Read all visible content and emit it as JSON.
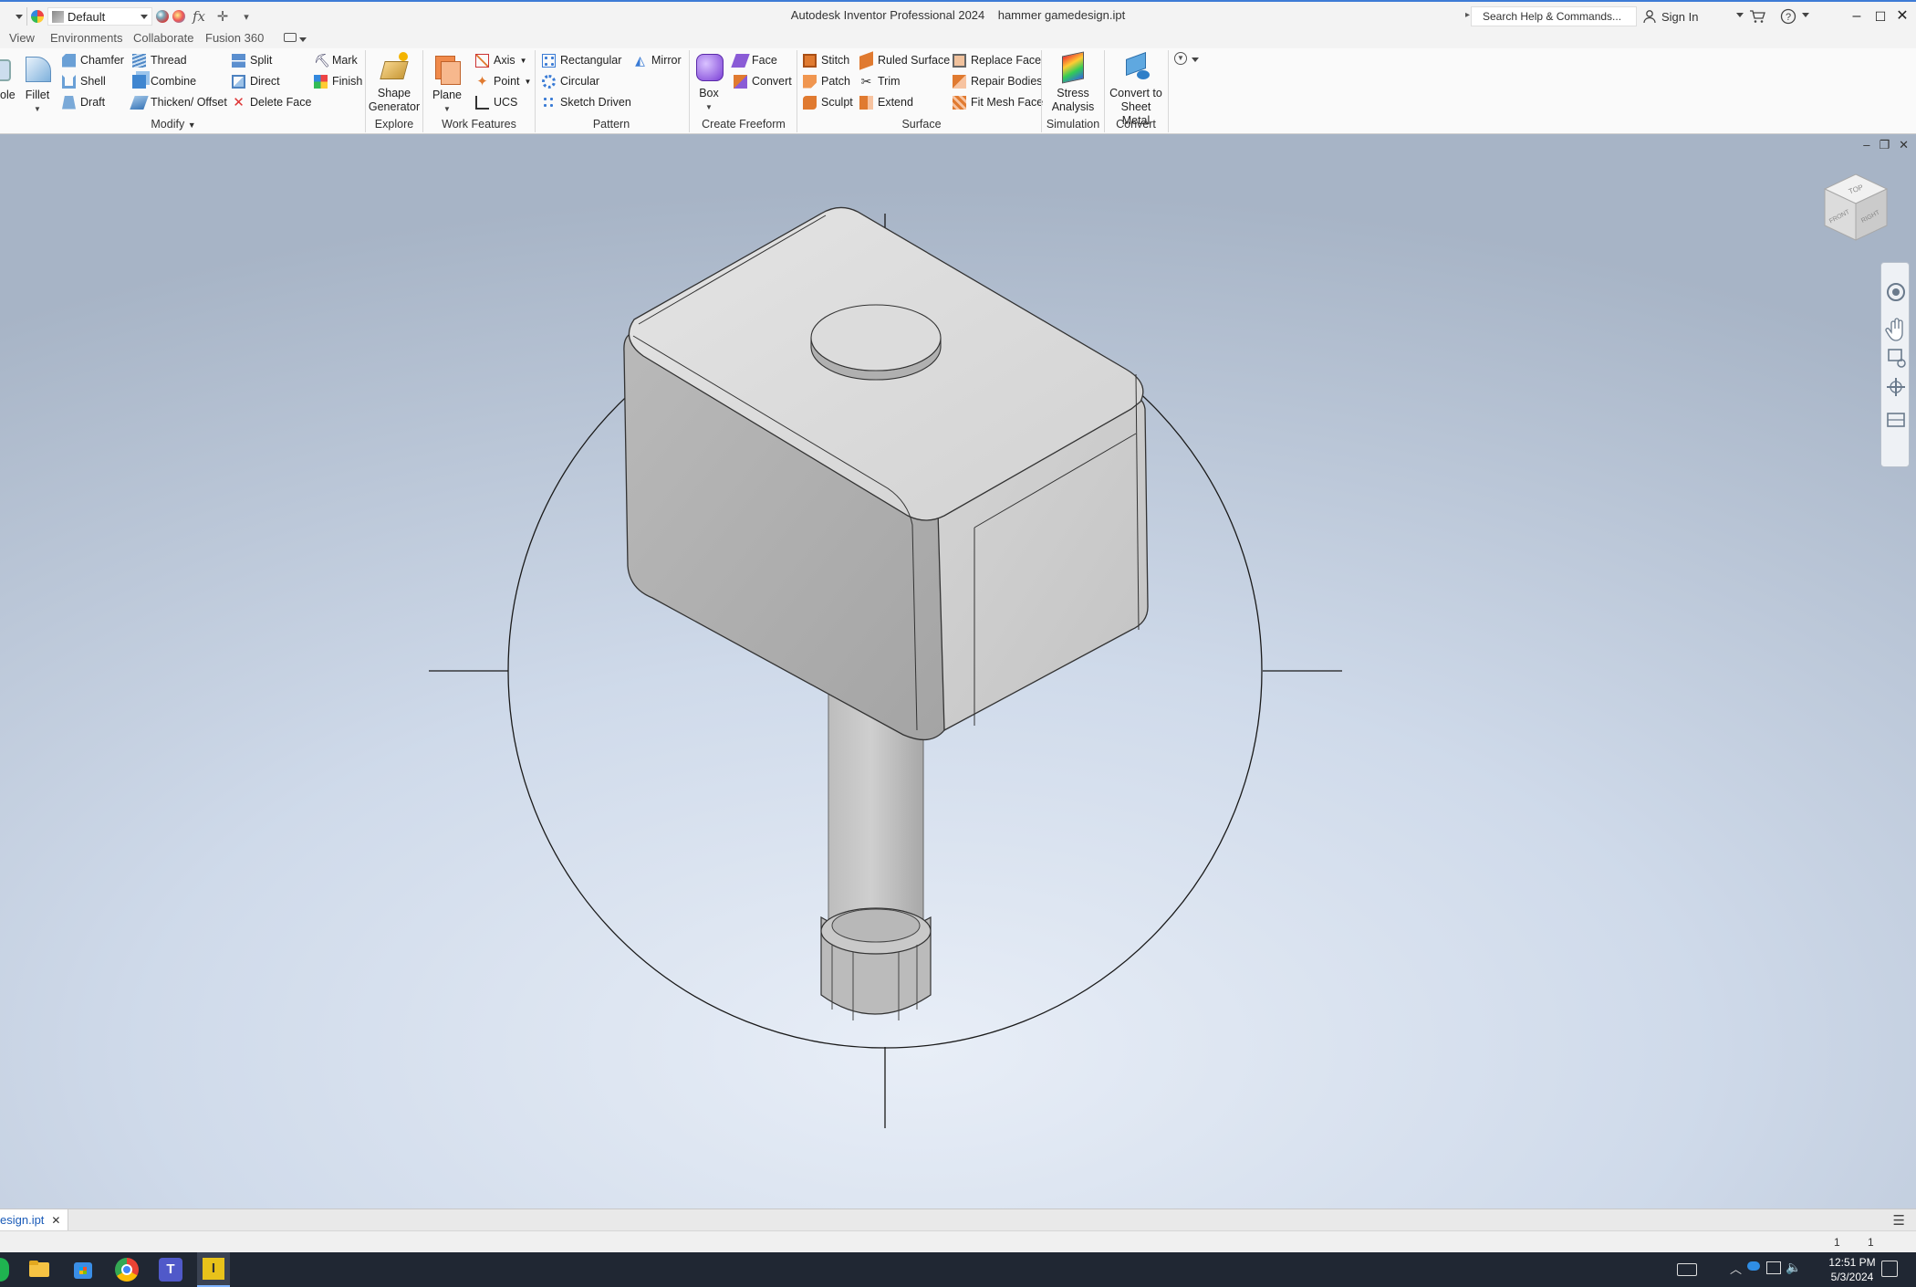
{
  "titlebar": {
    "appearance": "Default",
    "app_name": "Autodesk Inventor Professional 2024",
    "document": "hammer gamedesign.ipt",
    "search_placeholder": "Search Help & Commands...",
    "sign_in": "Sign In",
    "fx_glyph": "fx"
  },
  "ribbon_tabs": [
    "View",
    "Environments",
    "Collaborate",
    "Fusion 360"
  ],
  "ribbon": {
    "modify": {
      "partial": "ole",
      "fillet": "Fillet",
      "chamfer": "Chamfer",
      "shell": "Shell",
      "draft": "Draft",
      "thread": "Thread",
      "combine": "Combine",
      "thicken": "Thicken/ Offset",
      "split": "Split",
      "direct": "Direct",
      "delete_face": "Delete Face",
      "mark": "Mark",
      "finish": "Finish",
      "label": "Modify"
    },
    "explore": {
      "shape_generator_1": "Shape",
      "shape_generator_2": "Generator",
      "label": "Explore"
    },
    "work_features": {
      "plane": "Plane",
      "axis": "Axis",
      "point": "Point",
      "ucs": "UCS",
      "label": "Work Features"
    },
    "pattern": {
      "rectangular": "Rectangular",
      "circular": "Circular",
      "sketch_driven": "Sketch Driven",
      "mirror": "Mirror",
      "label": "Pattern"
    },
    "freeform": {
      "box": "Box",
      "face": "Face",
      "convert": "Convert",
      "label": "Create Freeform"
    },
    "surface": {
      "stitch": "Stitch",
      "patch": "Patch",
      "sculpt": "Sculpt",
      "ruled_surface": "Ruled Surface",
      "trim": "Trim",
      "extend": "Extend",
      "replace_face": "Replace Face",
      "repair_bodies": "Repair Bodies",
      "fit_mesh_face": "Fit Mesh Face",
      "label": "Surface"
    },
    "simulation": {
      "stress_1": "Stress",
      "stress_2": "Analysis",
      "label": "Simulation"
    },
    "convert": {
      "sheet_1": "Convert to",
      "sheet_2": "Sheet Metal",
      "label": "Convert"
    }
  },
  "viewcube": {
    "top": "TOP",
    "front": "FRONT",
    "right": "RIGHT"
  },
  "doc_tab": {
    "label": "esign.ipt"
  },
  "status": {
    "left_num": "1",
    "right_num": "1"
  },
  "taskbar": {
    "time": "12:51 PM",
    "date": "5/3/2024"
  },
  "colors": {
    "accent": "#3d7bd6",
    "taskbar": "#202733",
    "viewport_center": "#e8eef7",
    "viewport_edge": "#a7b4c6",
    "model_gray": "#bdbdbd"
  }
}
